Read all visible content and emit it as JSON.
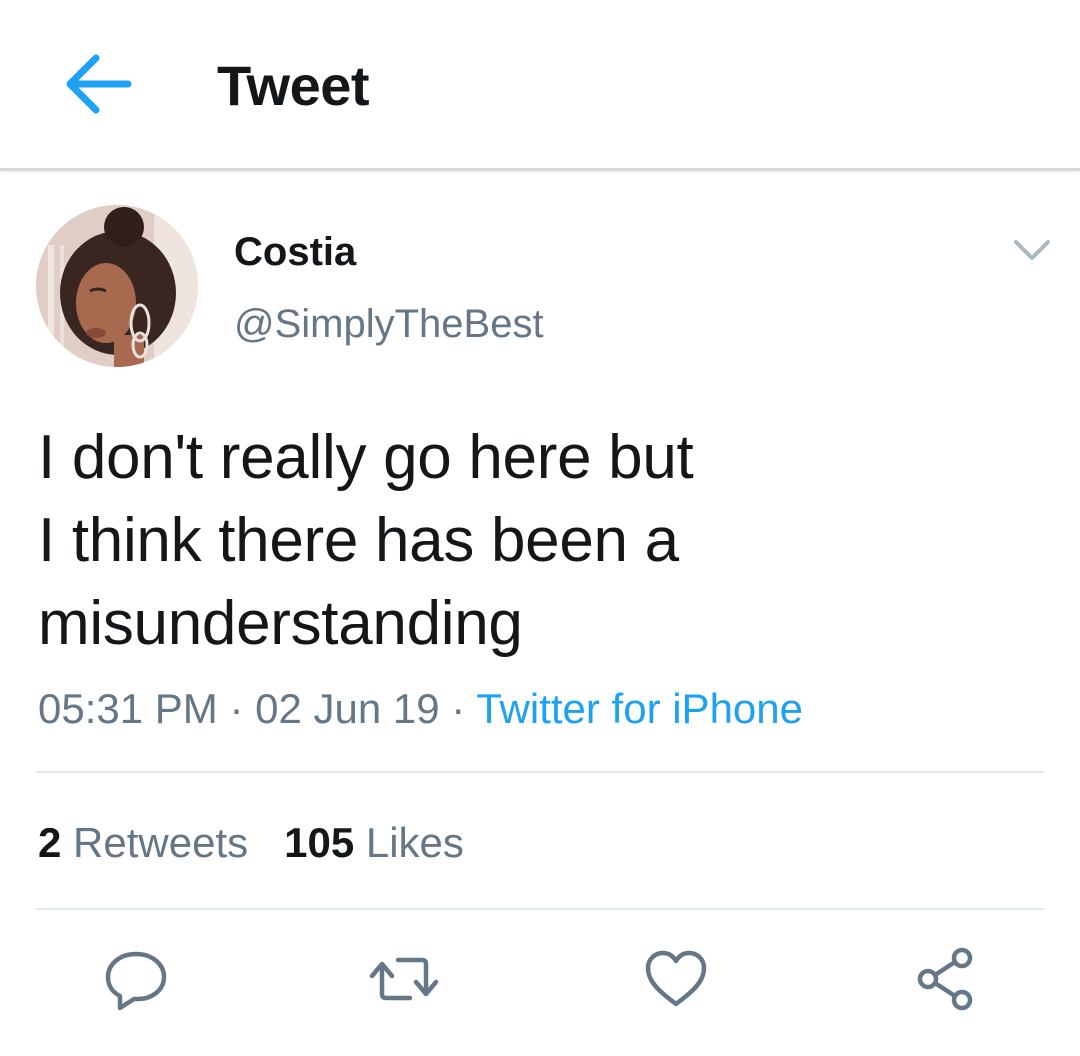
{
  "header": {
    "title": "Tweet",
    "back_icon": "arrow-left-icon"
  },
  "author": {
    "name": "Costia",
    "handle": "@SimplyTheBest"
  },
  "tweet": {
    "lines": [
      "I don't really go here but",
      "I think there has been a",
      "misunderstanding"
    ],
    "time": "05:31 PM",
    "separator": " · ",
    "date": "02 Jun 19",
    "source": "Twitter for iPhone"
  },
  "stats": {
    "retweets_count": "2",
    "retweets_label": "Retweets",
    "likes_count": "105",
    "likes_label": "Likes"
  },
  "actions": [
    "reply-icon",
    "retweet-icon",
    "like-icon",
    "share-icon"
  ],
  "colors": {
    "accent": "#1da1f2",
    "text_primary": "#14171a",
    "text_secondary": "#657786",
    "divider": "#e1e8ed",
    "icon": "#657786"
  }
}
